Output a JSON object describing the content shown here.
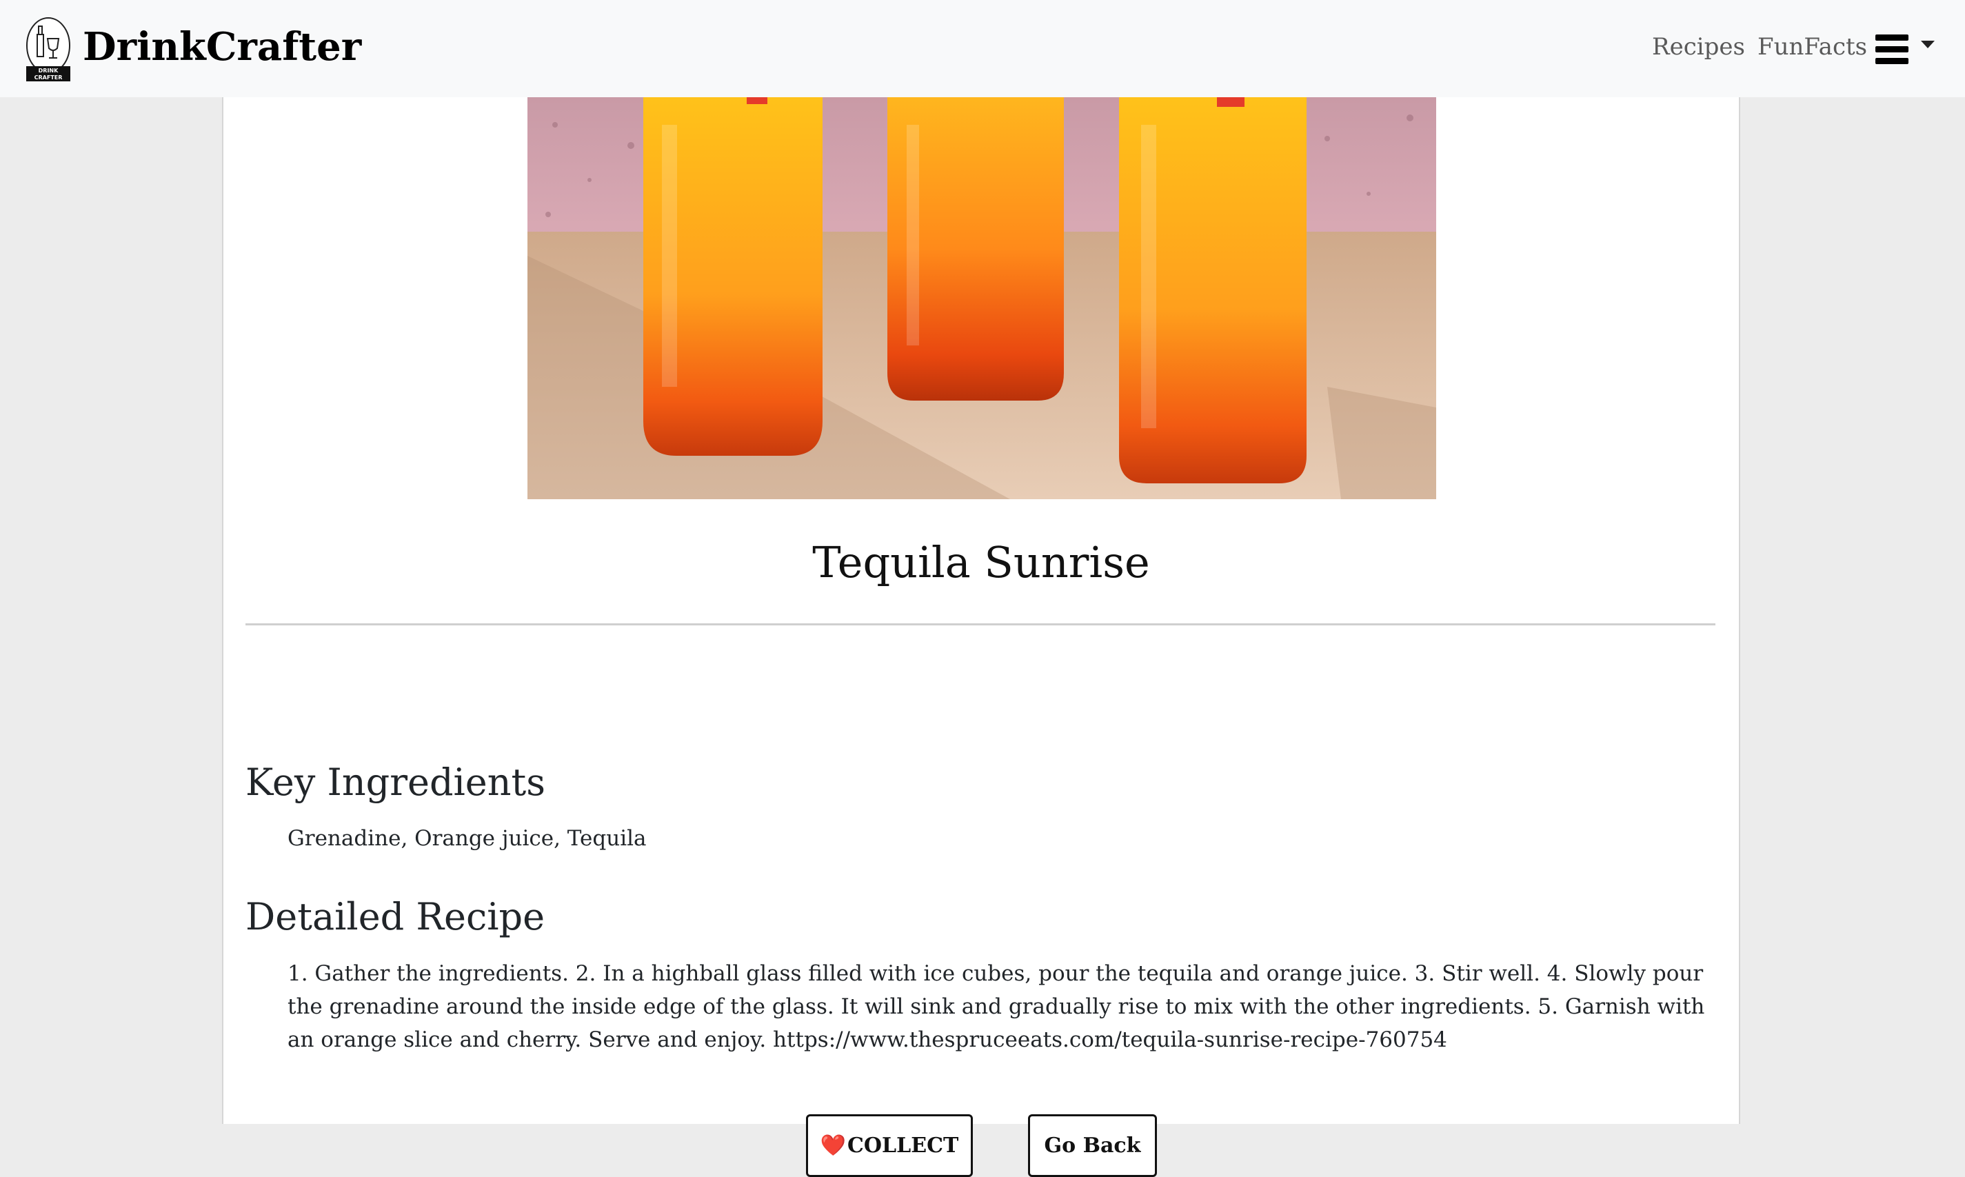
{
  "navbar": {
    "brand_name": "DrinkCrafter",
    "logo_icon": "drinkcrafter-logo-icon",
    "logo_text": "DRINK CRAFTER",
    "links": [
      {
        "label": "Recipes"
      },
      {
        "label": "FunFacts"
      }
    ],
    "menu_icon": "hamburger-menu-icon"
  },
  "drink": {
    "title": "Tequila Sunrise",
    "image_description_icon": "drink-photo"
  },
  "sections": {
    "ingredients_heading": "Key Ingredients",
    "ingredients": "Grenadine, Orange juice, Tequila",
    "recipe_heading": "Detailed Recipe",
    "recipe": "1. Gather the ingredients. 2. In a highball glass filled with ice cubes, pour the tequila and orange juice. 3. Stir well. 4. Slowly pour the grenadine around the inside edge of the glass. It will sink and gradually rise to mix with the other ingredients. 5. Garnish with an orange slice and cherry. Serve and enjoy. https://www.thespruceeats.com/tequila-sunrise-recipe-760754"
  },
  "buttons": {
    "collect_icon": "❤️",
    "collect_label": "COLLECT",
    "back_label": "Go Back"
  },
  "colors": {
    "navbar_bg": "#f8f9fa",
    "page_bg": "#ececec",
    "heart": "#d61f26"
  }
}
